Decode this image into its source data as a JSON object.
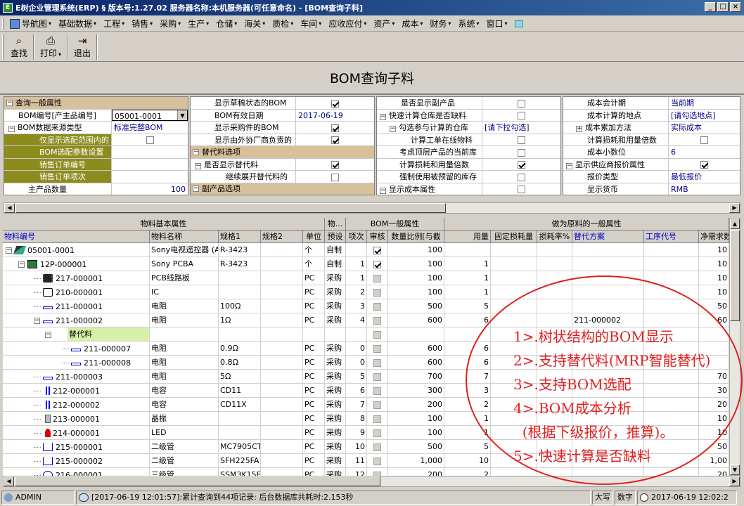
{
  "window": {
    "title": "E树企业管理系统(ERP) § 版本号:1.27.02  服务器名称:本机服务器(可任意命名) - [BOM查询子料]",
    "icon": "E",
    "buttons": [
      "_",
      "□",
      "×"
    ]
  },
  "menubar": {
    "items": [
      {
        "label": "导航图",
        "dd": "▾"
      },
      {
        "label": "基础数据",
        "dd": "▾"
      },
      {
        "label": "工程",
        "dd": "▾"
      },
      {
        "label": "销售",
        "dd": "▾"
      },
      {
        "label": "采购",
        "dd": "▾"
      },
      {
        "label": "生产",
        "dd": "▾"
      },
      {
        "label": "仓储",
        "dd": "▾"
      },
      {
        "label": "海关",
        "dd": "▾"
      },
      {
        "label": "质检",
        "dd": "▾"
      },
      {
        "label": "车间",
        "dd": "▾"
      },
      {
        "label": "应收应付",
        "dd": "▾"
      },
      {
        "label": "资产",
        "dd": "▾"
      },
      {
        "label": "成本",
        "dd": "▾"
      },
      {
        "label": "财务",
        "dd": "▾"
      },
      {
        "label": "系统",
        "dd": "▾"
      },
      {
        "label": "窗口",
        "dd": "▾"
      }
    ]
  },
  "toolbar": {
    "find": {
      "label": "查找",
      "icon": "binoculars-icon",
      "glyph": "⌕"
    },
    "print": {
      "label": "打印",
      "icon": "printer-icon",
      "glyph": "⎙",
      "dd": "▾"
    },
    "exit": {
      "label": "退出",
      "icon": "exit-icon",
      "glyph": "⇥"
    }
  },
  "page": {
    "title": "BOM查询子料"
  },
  "props1": {
    "category": "查询一般属性",
    "toggle": "−",
    "bom_no_label": "BOM编号[产主品编号]",
    "bom_no_value": "05001-0001",
    "source_label": "BOM数据来源类型",
    "source_value": "标准完整BOM",
    "only_scope_label": "仅显示选配范围内的",
    "config_label": "BOM选配参数设置",
    "so_no_label": "销售订单编号",
    "so_item_label": "销售订单项次",
    "qty_label": "主产品数量",
    "qty_value": "100"
  },
  "props2": {
    "draft_label": "显示草稿状态的BOM",
    "date_label": "BOM有效日期",
    "date_value": "2017-06-19",
    "purchased_label": "显示采购件的BOM",
    "outsource_label": "显示由外协厂商负责的",
    "sub_cat": "替代料选项",
    "show_sub_label": "是否显示替代料",
    "expand_sub_label": "继续展开替代料的",
    "byprod_cat": "副产品选项"
  },
  "props3": {
    "show_byprod_label": "是否显示副产品",
    "fast_calc_label": "快速计算仓库是否缺料",
    "warehouses_label": "勾选参与计算的仓库",
    "warehouses_value": "[请下拉勾选]",
    "online_label": "计算工单在线物料",
    "top_label": "考虑顶层产品的当前库",
    "loss_label": "计算损耗和用量倍数",
    "reserved_label": "强制使用被预留的库存",
    "cost_label": "显示成本属性"
  },
  "props4": {
    "period_label": "成本会计期",
    "period_value": "当前期",
    "site_label": "成本计算的地点",
    "site_value": "[请勾选地点]",
    "method_label": "成本累加方法",
    "method_value": "实际成本",
    "loss_label": "计算损耗和用量倍数",
    "decimals_label": "成本小数位",
    "decimals_value": "6",
    "vendor_label": "显示供应商报价属性",
    "quote_label": "报价类型",
    "quote_value": "最低报价",
    "currency_label": "显示货币",
    "currency_value": "RMB"
  },
  "grid": {
    "groups": [
      "物料基本属性",
      "物...",
      "BOM一般属性",
      "做为原料的一般属性"
    ],
    "columns": [
      "物料编号",
      "物料名称",
      "规格1",
      "规格2",
      "单位",
      "预设",
      "项次",
      "审核",
      "数量比例[与截",
      "用量",
      "固定损耗量",
      "损耗率%",
      "替代方案",
      "工序代号",
      "净需求数"
    ],
    "rows": [
      {
        "code": "05001-0001",
        "name": "Sony电视遥控器 (A",
        "spec1": "R-3423",
        "unit": "个",
        "preset": "自制",
        "seq": "",
        "approved": "on",
        "ratio": "100",
        "usage": "",
        "fixed": "",
        "rate": "",
        "alt": "",
        "op": "",
        "net": "10",
        "icon": "remote-icon",
        "level": 0
      },
      {
        "code": "12P-000001",
        "name": "Sony PCBA",
        "spec1": "R-3423",
        "unit": "个",
        "preset": "自制",
        "seq": "1",
        "approved": "on",
        "ratio": "100",
        "usage": "1",
        "fixed": "",
        "rate": "",
        "alt": "",
        "op": "",
        "net": "10",
        "icon": "pcba-icon",
        "level": 1
      },
      {
        "code": "217-000001",
        "name": "PCB线路板",
        "spec1": "",
        "unit": "PC",
        "preset": "采购",
        "seq": "1",
        "approved": "dis",
        "ratio": "100",
        "usage": "1",
        "fixed": "",
        "rate": "",
        "alt": "",
        "op": "",
        "net": "10",
        "icon": "chip-icon",
        "level": 2
      },
      {
        "code": "210-000001",
        "name": "IC",
        "spec1": "",
        "unit": "PC",
        "preset": "采购",
        "seq": "2",
        "approved": "dis",
        "ratio": "100",
        "usage": "1",
        "fixed": "",
        "rate": "",
        "alt": "",
        "op": "",
        "net": "10",
        "icon": "ic-icon",
        "level": 2
      },
      {
        "code": "211-000001",
        "name": "电阻",
        "spec1": "100Ω",
        "unit": "PC",
        "preset": "采购",
        "seq": "3",
        "approved": "dis",
        "ratio": "500",
        "usage": "5",
        "fixed": "",
        "rate": "",
        "alt": "",
        "op": "",
        "net": "50",
        "icon": "resistor-icon",
        "level": 2
      },
      {
        "code": "211-000002",
        "name": "电阻",
        "spec1": "1Ω",
        "unit": "PC",
        "preset": "采购",
        "seq": "4",
        "approved": "dis",
        "ratio": "600",
        "usage": "6",
        "fixed": "",
        "rate": "",
        "alt": "211-000002",
        "op": "",
        "net": "60",
        "icon": "resistor-icon",
        "level": 2
      },
      {
        "code": "",
        "name": "",
        "spec1": "",
        "unit": "",
        "preset": "",
        "seq": "",
        "approved": "dis",
        "ratio": "",
        "usage": "",
        "fixed": "",
        "rate": "",
        "alt": "",
        "op": "",
        "net": "",
        "sublabel": "替代料",
        "level": 3
      },
      {
        "code": "211-000007",
        "name": "电阻",
        "spec1": "0.9Ω",
        "unit": "PC",
        "preset": "采购",
        "seq": "0",
        "approved": "dis",
        "ratio": "600",
        "usage": "6",
        "fixed": "",
        "rate": "",
        "alt": "",
        "op": "",
        "net": "",
        "icon": "resistor-icon",
        "level": 4
      },
      {
        "code": "211-000008",
        "name": "电阻",
        "spec1": "0.8Ω",
        "unit": "PC",
        "preset": "采购",
        "seq": "0",
        "approved": "dis",
        "ratio": "600",
        "usage": "6",
        "fixed": "",
        "rate": "",
        "alt": "",
        "op": "",
        "net": "",
        "icon": "resistor-icon",
        "level": 4
      },
      {
        "code": "211-000003",
        "name": "电阻",
        "spec1": "5Ω",
        "unit": "PC",
        "preset": "采购",
        "seq": "5",
        "approved": "dis",
        "ratio": "700",
        "usage": "7",
        "fixed": "",
        "rate": "",
        "alt": "",
        "op": "",
        "net": "70",
        "icon": "resistor-icon",
        "level": 2
      },
      {
        "code": "212-000001",
        "name": "电容",
        "spec1": "CD11",
        "unit": "PC",
        "preset": "采购",
        "seq": "6",
        "approved": "dis",
        "ratio": "300",
        "usage": "3",
        "fixed": "",
        "rate": "",
        "alt": "",
        "op": "",
        "net": "30",
        "icon": "capacitor-icon",
        "level": 2
      },
      {
        "code": "212-000002",
        "name": "电容",
        "spec1": "CD11X",
        "unit": "PC",
        "preset": "采购",
        "seq": "7",
        "approved": "dis",
        "ratio": "200",
        "usage": "2",
        "fixed": "",
        "rate": "",
        "alt": "",
        "op": "",
        "net": "20",
        "icon": "capacitor-icon",
        "level": 2
      },
      {
        "code": "213-000001",
        "name": "晶振",
        "spec1": "",
        "unit": "PC",
        "preset": "采购",
        "seq": "8",
        "approved": "dis",
        "ratio": "100",
        "usage": "1",
        "fixed": "",
        "rate": "",
        "alt": "",
        "op": "",
        "net": "10",
        "icon": "crystal-icon",
        "level": 2
      },
      {
        "code": "214-000001",
        "name": "LED",
        "spec1": "",
        "unit": "PC",
        "preset": "采购",
        "seq": "9",
        "approved": "dis",
        "ratio": "100",
        "usage": "1",
        "fixed": "",
        "rate": "",
        "alt": "",
        "op": "",
        "net": "10",
        "icon": "led-icon",
        "level": 2
      },
      {
        "code": "215-000001",
        "name": "二级管",
        "spec1": "MC7905CT",
        "unit": "PC",
        "preset": "采购",
        "seq": "10",
        "approved": "dis",
        "ratio": "500",
        "usage": "5",
        "fixed": "",
        "rate": "",
        "alt": "",
        "op": "",
        "net": "50",
        "icon": "diode-icon",
        "level": 2
      },
      {
        "code": "215-000002",
        "name": "二级管",
        "spec1": "SFH225FA",
        "unit": "PC",
        "preset": "采购",
        "seq": "11",
        "approved": "dis",
        "ratio": "1,000",
        "usage": "10",
        "fixed": "",
        "rate": "",
        "alt": "",
        "op": "",
        "net": "1,00",
        "icon": "diode-icon",
        "level": 2
      },
      {
        "code": "216-000001",
        "name": "三级管",
        "spec1": "SSM3K15FS",
        "unit": "PC",
        "preset": "采购",
        "seq": "12",
        "approved": "dis",
        "ratio": "200",
        "usage": "2",
        "fixed": "",
        "rate": "",
        "alt": "",
        "op": "",
        "net": "20",
        "icon": "transistor-icon",
        "level": 2
      }
    ]
  },
  "annotation": {
    "lines": [
      "1>.树状结构的BOM显示",
      "2>.支持替代料(MRP智能替代)",
      "3>.支持BOM选配",
      "4>.BOM成本分析",
      "  (根据下级报价，推算)。",
      "5>.快速计算是否缺料"
    ]
  },
  "status": {
    "user": "ADMIN",
    "message": "[2017-06-19 12:01:57]:累计查询到44项记录: 后台数据库共耗时:2.153秒",
    "caps": "大写",
    "num": "数字",
    "time": "2017-06-19 12:02:2"
  },
  "colors": {
    "title_bar": "#0a246a",
    "category_bg": "#d7c09c",
    "olive_cell": "#8c8c1e",
    "annotation_red": "#e02020",
    "link_blue": "#0000cc"
  }
}
